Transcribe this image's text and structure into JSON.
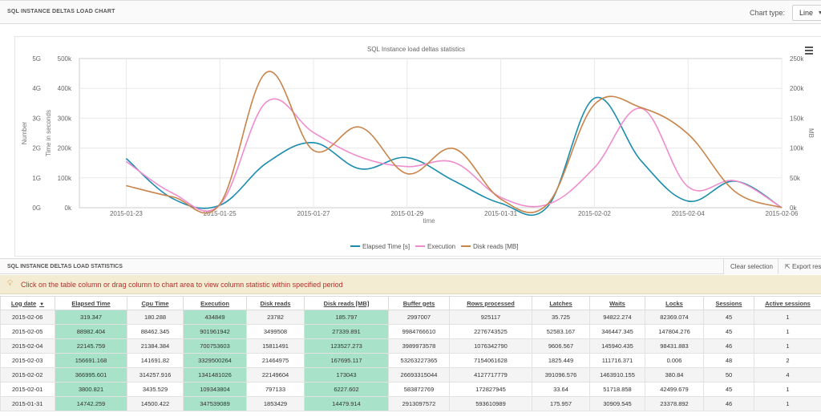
{
  "chart_panel": {
    "title": "SQL INSTANCE DELTAS LOAD CHART",
    "chart_type_label": "Chart type:",
    "chart_type_value": "Line",
    "menu_icon": "hamburger-menu-icon"
  },
  "chart_data": {
    "type": "line",
    "title": "SQL Instance load deltas statistics",
    "xlabel": "time",
    "x_ticks": [
      "2015-01-23",
      "2015-01-25",
      "2015-01-27",
      "2015-01-29",
      "2015-01-31",
      "2015-02-02",
      "2015-02-04",
      "2015-02-06"
    ],
    "xlim": [
      "2015-01-22",
      "2015-02-06"
    ],
    "axes": [
      {
        "label": "Number",
        "ticks": [
          "0G",
          "1G",
          "2G",
          "3G",
          "4G",
          "5G"
        ],
        "range": [
          0,
          5000000000
        ]
      },
      {
        "label": "Time in seconds",
        "ticks": [
          "0k",
          "100k",
          "200k",
          "300k",
          "400k",
          "500k"
        ],
        "range": [
          0,
          500000
        ]
      },
      {
        "label": "MB",
        "ticks": [
          "0k",
          "50k",
          "100k",
          "150k",
          "200k",
          "250k"
        ],
        "range": [
          0,
          250000
        ]
      }
    ],
    "grid": true,
    "legend_position": "bottom-center",
    "series": [
      {
        "name": "Elapsed Time [s]",
        "color": "#1a8cae",
        "axis": "Time in seconds",
        "points": [
          [
            "2015-01-23",
            165000
          ],
          [
            "2015-01-24",
            30000
          ],
          [
            "2015-01-25",
            8000
          ],
          [
            "2015-01-26",
            150000
          ],
          [
            "2015-01-27",
            218000
          ],
          [
            "2015-01-28",
            130000
          ],
          [
            "2015-01-29",
            168000
          ],
          [
            "2015-01-30",
            90000
          ],
          [
            "2015-01-31",
            14742
          ],
          [
            "2015-02-01",
            3800
          ],
          [
            "2015-02-02",
            366995
          ],
          [
            "2015-02-03",
            156691
          ],
          [
            "2015-02-04",
            22145
          ],
          [
            "2015-02-05",
            88982
          ],
          [
            "2015-02-06",
            319
          ]
        ]
      },
      {
        "name": "Execution",
        "color": "#f08ccd",
        "axis": "Number",
        "points": [
          [
            "2015-01-23",
            1550000000
          ],
          [
            "2015-01-24",
            480000000
          ],
          [
            "2015-01-25",
            100000000
          ],
          [
            "2015-01-26",
            3550000000
          ],
          [
            "2015-01-27",
            2520000000
          ],
          [
            "2015-01-28",
            1700000000
          ],
          [
            "2015-01-29",
            1380000000
          ],
          [
            "2015-01-30",
            1520000000
          ],
          [
            "2015-01-31",
            347539089
          ],
          [
            "2015-02-01",
            109343804
          ],
          [
            "2015-02-02",
            1341481026
          ],
          [
            "2015-02-03",
            3329500264
          ],
          [
            "2015-02-04",
            700753603
          ],
          [
            "2015-02-05",
            901961942
          ],
          [
            "2015-02-06",
            434849
          ]
        ]
      },
      {
        "name": "Disk reads [MB]",
        "color": "#c8844a",
        "axis": "MB",
        "points": [
          [
            "2015-01-23",
            37000
          ],
          [
            "2015-01-24",
            18000
          ],
          [
            "2015-01-25",
            6000
          ],
          [
            "2015-01-26",
            227000
          ],
          [
            "2015-01-27",
            96000
          ],
          [
            "2015-01-28",
            135000
          ],
          [
            "2015-01-29",
            57000
          ],
          [
            "2015-01-30",
            99000
          ],
          [
            "2015-01-31",
            14479
          ],
          [
            "2015-02-01",
            6227
          ],
          [
            "2015-02-02",
            173043
          ],
          [
            "2015-02-03",
            167695
          ],
          [
            "2015-02-04",
            123527
          ],
          [
            "2015-02-05",
            27339
          ],
          [
            "2015-02-06",
            185
          ]
        ]
      }
    ]
  },
  "stats_panel": {
    "title": "SQL INSTANCE DELTAS LOAD STATISTICS",
    "clear_selection": "Clear selection",
    "export_label": "Export resu",
    "info_text": "Click on the table column or drag column to chart area to view column statistic within specified period",
    "columns": [
      "Log date",
      "Elapsed Time",
      "Cpu Time",
      "Execution",
      "Disk reads",
      "Disk reads [MB]",
      "Buffer gets",
      "Rows processed",
      "Latches",
      "Waits",
      "Locks",
      "Sessions",
      "Active sessions"
    ],
    "rows": [
      [
        "2015-02-06",
        "319.347",
        "180.288",
        "434849",
        "23782",
        "185.797",
        "2997007",
        "925117",
        "35.725",
        "94822.274",
        "82369.074",
        "45",
        "1"
      ],
      [
        "2015-02-05",
        "88982.404",
        "88462.345",
        "901961942",
        "3499508",
        "27339.891",
        "9984766610",
        "2276743525",
        "52583.167",
        "346447.345",
        "147804.276",
        "45",
        "1"
      ],
      [
        "2015-02-04",
        "22145.759",
        "21384.384",
        "700753603",
        "15811491",
        "123527.273",
        "3989973578",
        "1076342790",
        "9606.567",
        "145940.435",
        "98431.883",
        "46",
        "1"
      ],
      [
        "2015-02-03",
        "156691.168",
        "141691.82",
        "3329500264",
        "21464975",
        "167695.117",
        "53263227365",
        "7154061628",
        "1825.449",
        "111716.371",
        "0.006",
        "48",
        "2"
      ],
      [
        "2015-02-02",
        "366995.601",
        "314257.916",
        "1341481026",
        "22149604",
        "173043",
        "26693315044",
        "4127717779",
        "391096.576",
        "1463910.155",
        "380.84",
        "50",
        "4"
      ],
      [
        "2015-02-01",
        "3800.821",
        "3435.529",
        "109343804",
        "797133",
        "6227.602",
        "583872769",
        "172827945",
        "33.64",
        "51718.858",
        "42499.679",
        "45",
        "1"
      ],
      [
        "2015-01-31",
        "14742.259",
        "14500.422",
        "347539089",
        "1853429",
        "14479.914",
        "2913097572",
        "593610989",
        "175.957",
        "30909.545",
        "23378.892",
        "46",
        "1"
      ]
    ]
  }
}
